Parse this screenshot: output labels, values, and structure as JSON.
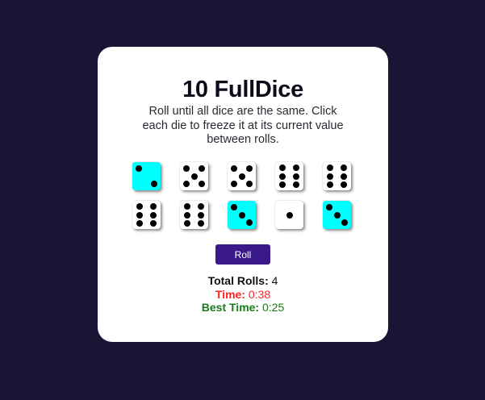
{
  "title": "10 FullDice",
  "description": "Roll until all dice are the same. Click each die to freeze it at its current value between rolls.",
  "dice": [
    {
      "value": 2,
      "frozen": true
    },
    {
      "value": 5,
      "frozen": false
    },
    {
      "value": 5,
      "frozen": false
    },
    {
      "value": 6,
      "frozen": false
    },
    {
      "value": 6,
      "frozen": false
    },
    {
      "value": 6,
      "frozen": false
    },
    {
      "value": 6,
      "frozen": false
    },
    {
      "value": 3,
      "frozen": true
    },
    {
      "value": 1,
      "frozen": false
    },
    {
      "value": 3,
      "frozen": true
    }
  ],
  "roll_label": "Roll",
  "stats": {
    "total_rolls_label": "Total Rolls:",
    "total_rolls_value": "4",
    "time_label": "Time:",
    "time_value": "0:38",
    "best_time_label": "Best Time:",
    "best_time_value": "0:25"
  },
  "colors": {
    "background": "#1b1435",
    "card": "#ffffff",
    "frozen_die": "#00ffff",
    "button": "#3a1a8a",
    "time": "#ff2020",
    "best_time": "#1a7a1a"
  }
}
